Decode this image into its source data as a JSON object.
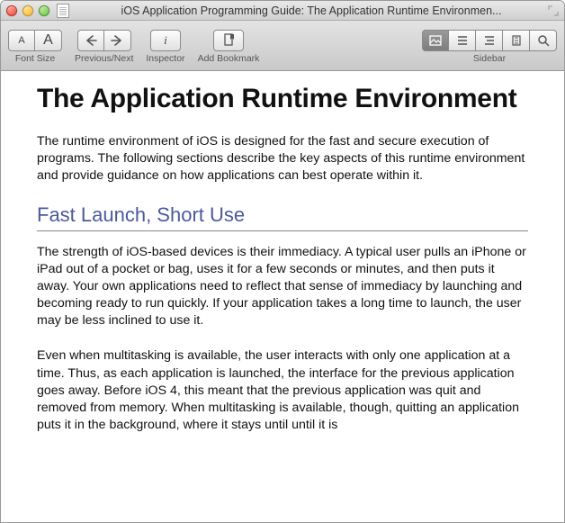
{
  "window": {
    "title": "iOS Application Programming Guide: The Application Runtime Environmen..."
  },
  "toolbar": {
    "font_size_label": "Font Size",
    "prev_next_label": "Previous/Next",
    "inspector_label": "Inspector",
    "add_bookmark_label": "Add Bookmark",
    "sidebar_label": "Sidebar",
    "font_small": "A",
    "font_large": "A"
  },
  "doc": {
    "h1": "The Application Runtime Environment",
    "p1": "The runtime environment of iOS is designed for the fast and secure execution of programs. The following sections describe the key aspects of this runtime environment and provide guidance on how applications can best operate within it.",
    "h2": "Fast Launch, Short Use",
    "p2": "The strength of iOS-based devices is their immediacy. A typical user pulls an iPhone or iPad out of a pocket or bag, uses it for a few seconds or minutes, and then puts it away. Your own applications need to reflect that sense of immediacy by launching and becoming ready to run quickly. If your application takes a long time to launch, the user may be less inclined to use it.",
    "p3": "Even when multitasking is available, the user interacts with only one application at a time. Thus, as each application is launched, the interface for the previous application goes away. Before iOS 4, this meant that the previous application was quit and removed from memory. When multitasking is available, though, quitting an application puts it in the background, where it stays until until it is"
  }
}
